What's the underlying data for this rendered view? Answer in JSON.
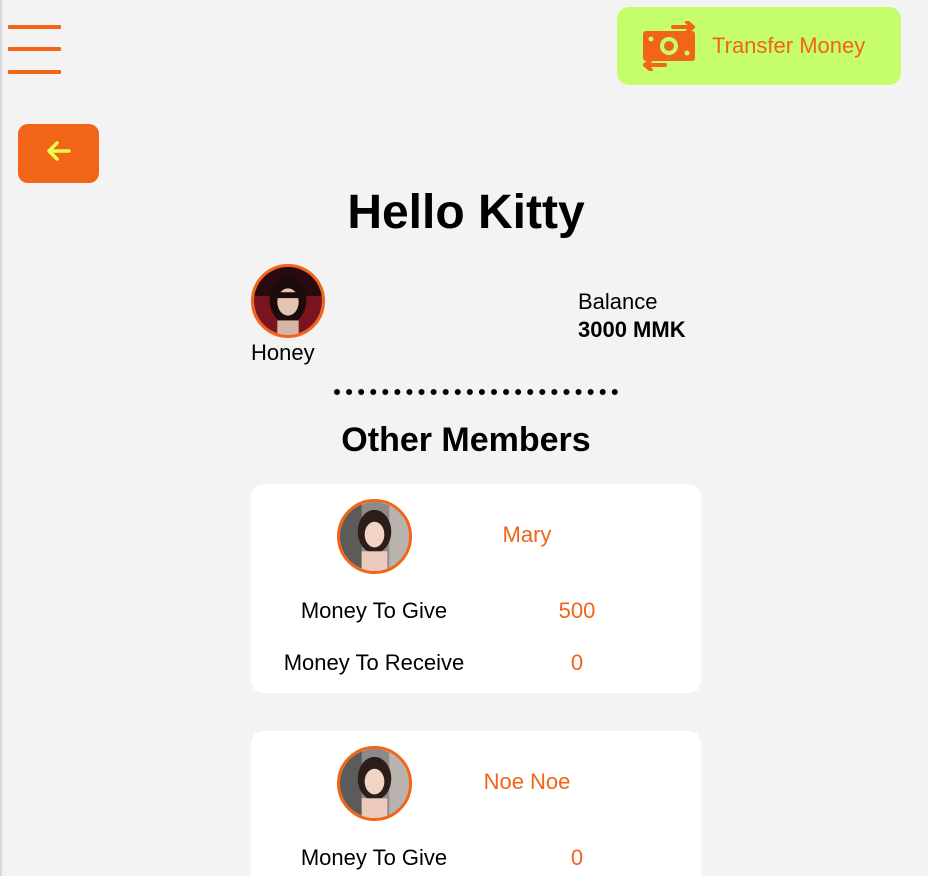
{
  "header": {
    "menu_icon": "hamburger-menu-icon",
    "transfer_label": "Transfer Money",
    "transfer_icon": "money-transfer-icon",
    "back_icon": "arrow-left-icon"
  },
  "page_title": "Hello Kitty",
  "current_user": {
    "name": "Honey",
    "balance_label": "Balance",
    "balance_value": "3000 MMK"
  },
  "section_title": "Other Members",
  "members": [
    {
      "name": "Mary",
      "give_label": "Money To Give",
      "give_value": "500",
      "receive_label": "Money To Receive",
      "receive_value": "0"
    },
    {
      "name": "Noe Noe",
      "give_label": "Money To Give",
      "give_value": "0"
    }
  ],
  "colors": {
    "accent": "#f26418",
    "transfer_bg": "#c6fd6b",
    "back_arrow": "#e9ff4a",
    "background": "#f3f3f3",
    "card_bg": "#ffffff"
  }
}
